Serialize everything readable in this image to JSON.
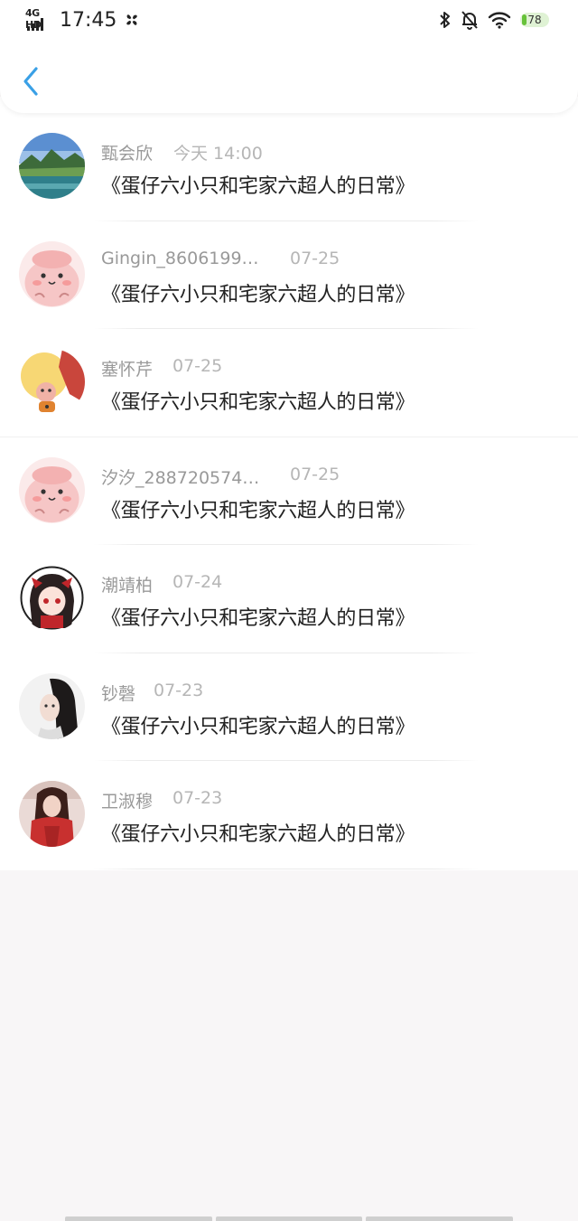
{
  "status_bar": {
    "network": "4G HD",
    "time": "17:45",
    "battery": "78"
  },
  "header": {
    "back_icon": "chevron-left-icon",
    "accent_color": "#3aa0e6"
  },
  "items": [
    {
      "name": "甄会欣",
      "date": "今天 14:00",
      "title": "《蛋仔六小只和宅家六超人的日常》"
    },
    {
      "name": "Gingin_8606199…",
      "date": "07-25",
      "title": "《蛋仔六小只和宅家六超人的日常》"
    },
    {
      "name": "塞怀芹",
      "date": "07-25",
      "title": "《蛋仔六小只和宅家六超人的日常》"
    },
    {
      "name": "汐汐_288720574…",
      "date": "07-25",
      "title": "《蛋仔六小只和宅家六超人的日常》"
    },
    {
      "name": "潮靖柏",
      "date": "07-24",
      "title": "《蛋仔六小只和宅家六超人的日常》"
    },
    {
      "name": "钞磬",
      "date": "07-23",
      "title": "《蛋仔六小只和宅家六超人的日常》"
    },
    {
      "name": "卫淑穆",
      "date": "07-23",
      "title": "《蛋仔六小只和宅家六超人的日常》"
    }
  ]
}
